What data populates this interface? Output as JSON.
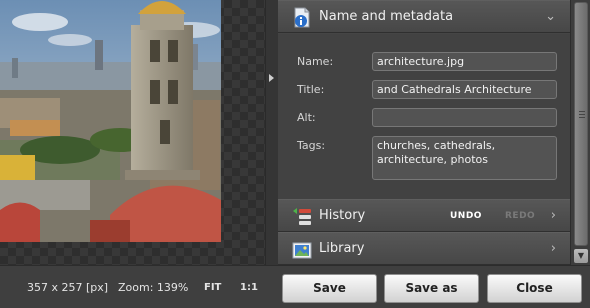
{
  "metadata_section": {
    "title": "Name and metadata",
    "name_label": "Name:",
    "name_value": "architecture.jpg",
    "title_label": "Title:",
    "title_value": " and Cathedrals Architecture",
    "alt_label": "Alt:",
    "alt_value": "",
    "tags_label": "Tags:",
    "tags_value": "churches, cathedrals, architecture, photos"
  },
  "history_section": {
    "title": "History",
    "undo_label": "UNDO",
    "redo_label": "REDO"
  },
  "library_section": {
    "title": "Library"
  },
  "footer": {
    "dimensions": "357 x 257 [px]",
    "zoom": "Zoom: 139%",
    "fit_label": "FIT",
    "one_to_one_label": "1:1",
    "save_label": "Save",
    "save_as_label": "Save as",
    "close_label": "Close"
  },
  "icons": {
    "metadata": "document-info-icon",
    "history": "history-icon",
    "library": "library-icon",
    "expand": "chevron-down-icon",
    "collapse": "chevron-right-icon"
  },
  "colors": {
    "undo_enabled": "#ffffff",
    "redo_disabled": "#7a7a7a"
  }
}
